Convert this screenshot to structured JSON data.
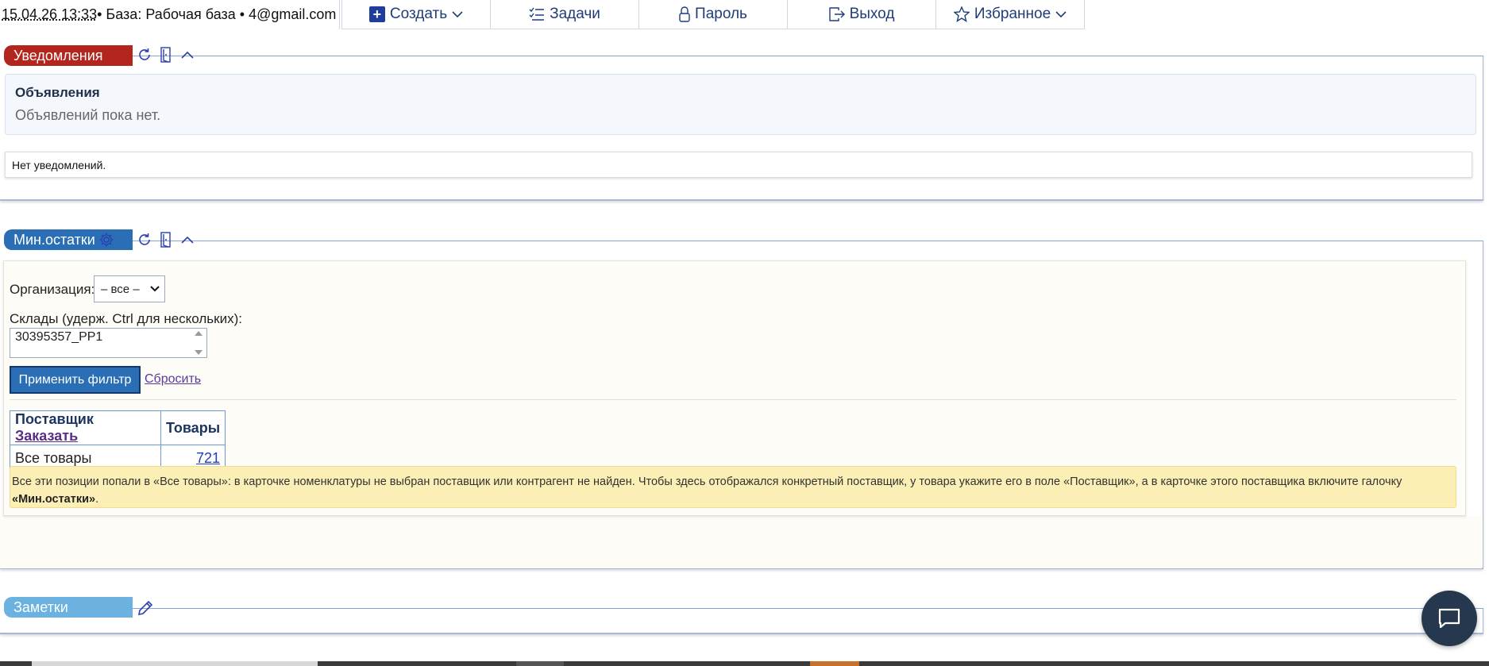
{
  "topbar": {
    "timestamp": "15.04.26 13:33",
    "base_info": " • База: Рабочая база • 4@gmail.com",
    "nav": {
      "create": "Создать",
      "tasks": "Задачи",
      "password": "Пароль",
      "logout": "Выход",
      "favorites": "Избранное"
    }
  },
  "notifications": {
    "tab": "Уведомления",
    "announcements_title": "Объявления",
    "announcements_text": "Объявлений пока нет.",
    "empty_text": "Нет уведомлений."
  },
  "min_stock": {
    "tab": "Мин.остатки",
    "org_label": "Организация:",
    "org_value": "– все –",
    "warehouses_label": "Склады (удерж. Ctrl для нескольких):",
    "warehouse_item": "30395357_РР1",
    "apply_button": "Применить фильтр",
    "reset_link": "Сбросить",
    "table": {
      "col_supplier": "Поставщик",
      "col_order": "Заказать",
      "col_goods": "Товары",
      "row_supplier": "Все товары",
      "row_goods": "721"
    },
    "warning_text": "Все эти позиции попали в «Все товары»: в карточке номенклатуры не выбран поставщик или контрагент не найден. Чтобы здесь отображался конкретный поставщик, у товара укажите его в поле «Поставщик», а в карточке этого поставщика включите галочку ",
    "warning_bold": "«Мин.остатки»",
    "warning_end": "."
  },
  "notes": {
    "tab": "Заметки"
  },
  "colors": {
    "tab_red": "#b3261e",
    "tab_blue": "#2a6fb6",
    "tab_light": "#6bb2e0",
    "nav_text": "#1f3d7a",
    "warning_bg": "#fcefb5"
  },
  "icons": {
    "refresh": "refresh-icon",
    "door": "door-icon",
    "collapse": "chevron-up-icon",
    "settings": "gear-icon",
    "edit": "pencil-icon",
    "chat": "chat-icon"
  }
}
